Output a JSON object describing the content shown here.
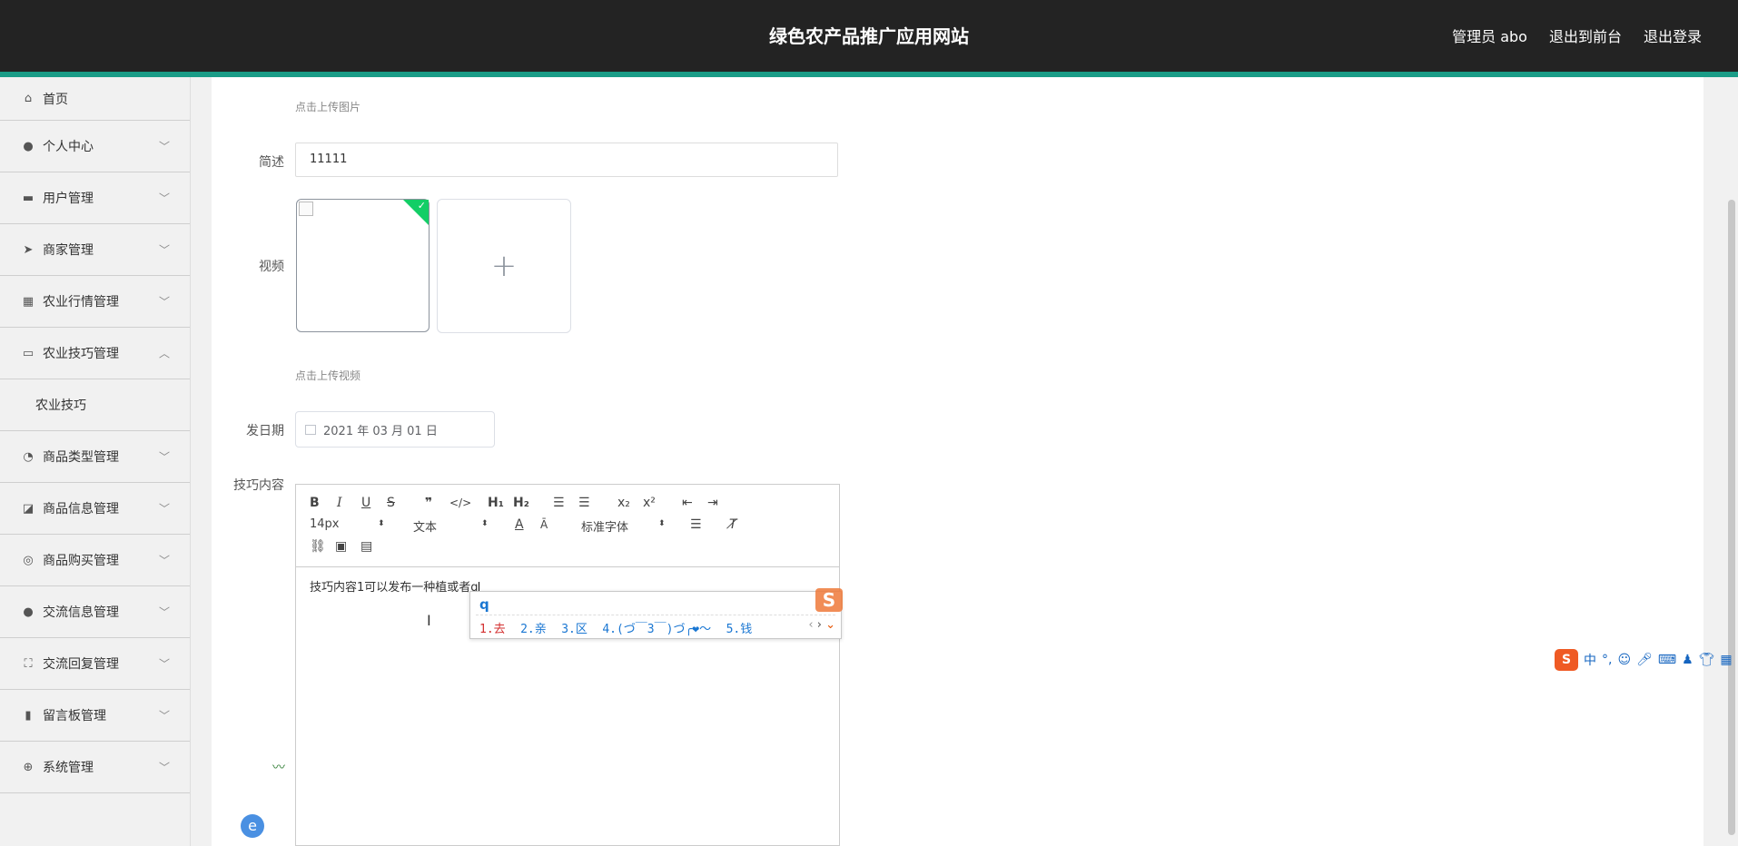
{
  "header": {
    "title": "绿色农产品推广应用网站",
    "links": [
      "管理员 abo",
      "退出到前台",
      "退出登录"
    ]
  },
  "sidebar": {
    "items": [
      {
        "label": "首页",
        "icon": "home-icon"
      },
      {
        "label": "个人中心",
        "icon": "user-icon"
      },
      {
        "label": "用户管理",
        "icon": "chat-icon"
      },
      {
        "label": "商家管理",
        "icon": "send-icon"
      },
      {
        "label": "农业行情管理",
        "icon": "grid-icon"
      },
      {
        "label": "农业技巧管理",
        "icon": "monitor-icon",
        "expanded": true,
        "sub": [
          "农业技巧"
        ]
      },
      {
        "label": "商品类型管理",
        "icon": "compass-icon"
      },
      {
        "label": "商品信息管理",
        "icon": "chart-icon"
      },
      {
        "label": "商品购买管理",
        "icon": "help-icon"
      },
      {
        "label": "交流信息管理",
        "icon": "user-icon"
      },
      {
        "label": "交流回复管理",
        "icon": "scan-icon"
      },
      {
        "label": "留言板管理",
        "icon": "bar-chart-icon"
      },
      {
        "label": "系统管理",
        "icon": "target-icon"
      }
    ]
  },
  "form": {
    "image_hint": "点击上传图片",
    "summary_label": "简述",
    "summary_value": "11111",
    "video_label": "视频",
    "video_hint": "点击上传视频",
    "date_label": "发日期",
    "date_value": "2021 年 03 月 01 日",
    "content_label": "技巧内容",
    "content_text": "技巧内容1可以发布一种植或者q"
  },
  "editor": {
    "font_size": "14px",
    "text_type": "文本",
    "font_family": "标准字体"
  },
  "ime": {
    "input": "q",
    "candidates": [
      "1.去",
      "2.亲",
      "3.区",
      "4.(づ￣3￣)づ╭❤～",
      "5.钱"
    ],
    "status": "中"
  }
}
